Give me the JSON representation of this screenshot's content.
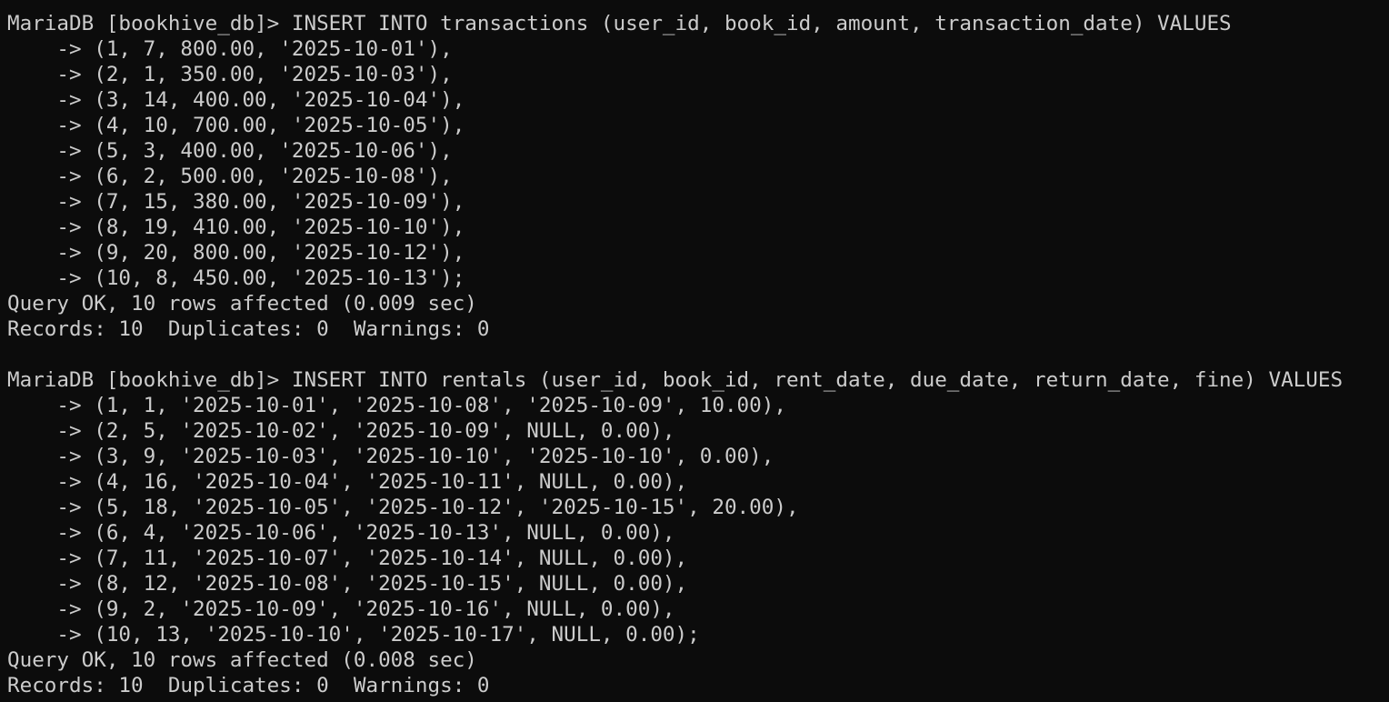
{
  "colors": {
    "background": "#0c0c0c",
    "foreground": "#cccccc"
  },
  "terminal": {
    "lines": [
      "MariaDB [bookhive_db]> INSERT INTO transactions (user_id, book_id, amount, transaction_date) VALUES",
      "    -> (1, 7, 800.00, '2025-10-01'),",
      "    -> (2, 1, 350.00, '2025-10-03'),",
      "    -> (3, 14, 400.00, '2025-10-04'),",
      "    -> (4, 10, 700.00, '2025-10-05'),",
      "    -> (5, 3, 400.00, '2025-10-06'),",
      "    -> (6, 2, 500.00, '2025-10-08'),",
      "    -> (7, 15, 380.00, '2025-10-09'),",
      "    -> (8, 19, 410.00, '2025-10-10'),",
      "    -> (9, 20, 800.00, '2025-10-12'),",
      "    -> (10, 8, 450.00, '2025-10-13');",
      "Query OK, 10 rows affected (0.009 sec)",
      "Records: 10  Duplicates: 0  Warnings: 0",
      "",
      "MariaDB [bookhive_db]> INSERT INTO rentals (user_id, book_id, rent_date, due_date, return_date, fine) VALUES",
      "    -> (1, 1, '2025-10-01', '2025-10-08', '2025-10-09', 10.00),",
      "    -> (2, 5, '2025-10-02', '2025-10-09', NULL, 0.00),",
      "    -> (3, 9, '2025-10-03', '2025-10-10', '2025-10-10', 0.00),",
      "    -> (4, 16, '2025-10-04', '2025-10-11', NULL, 0.00),",
      "    -> (5, 18, '2025-10-05', '2025-10-12', '2025-10-15', 20.00),",
      "    -> (6, 4, '2025-10-06', '2025-10-13', NULL, 0.00),",
      "    -> (7, 11, '2025-10-07', '2025-10-14', NULL, 0.00),",
      "    -> (8, 12, '2025-10-08', '2025-10-15', NULL, 0.00),",
      "    -> (9, 2, '2025-10-09', '2025-10-16', NULL, 0.00),",
      "    -> (10, 13, '2025-10-10', '2025-10-17', NULL, 0.00);",
      "Query OK, 10 rows affected (0.008 sec)",
      "Records: 10  Duplicates: 0  Warnings: 0"
    ]
  }
}
